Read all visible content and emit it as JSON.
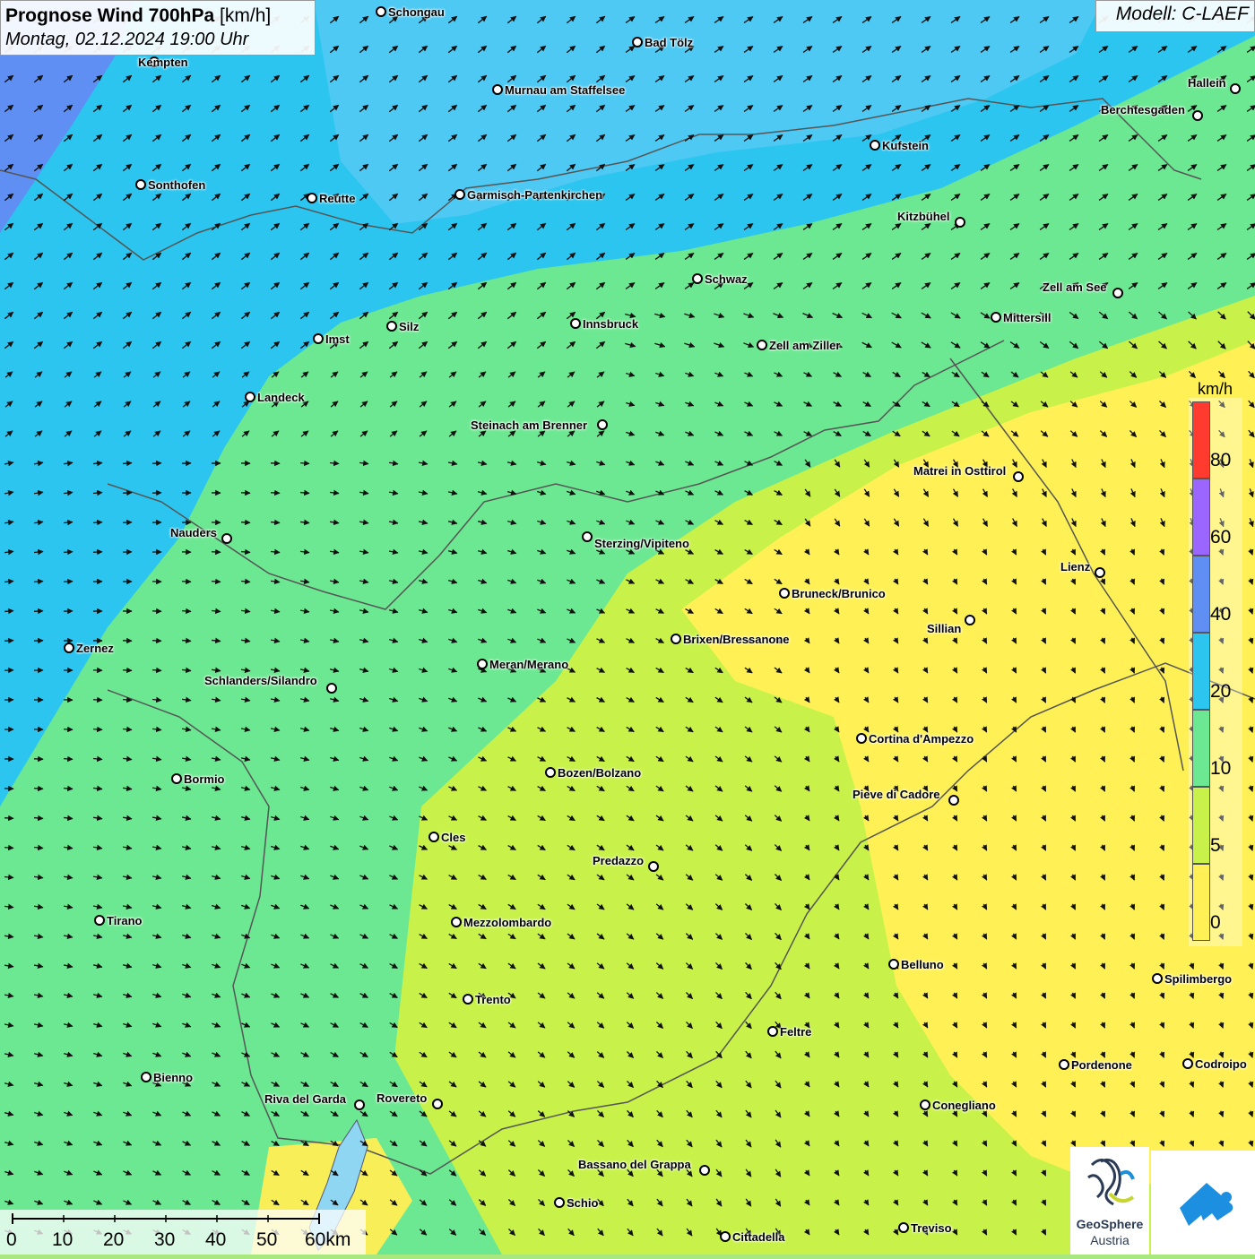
{
  "header": {
    "title_main": "Prognose Wind 700hPa",
    "title_unit": "[km/h]",
    "datetime": "Montag, 02.12.2024 19:00 Uhr",
    "model": "Modell: C-LAEF"
  },
  "legend": {
    "unit": "km/h",
    "labels": [
      "80",
      "60",
      "40",
      "20",
      "10",
      "5",
      "0"
    ],
    "colors": [
      "#ff3b30",
      "#9b66ff",
      "#5f8ff2",
      "#2bc5ef",
      "#6de892",
      "#c8f24a",
      "#fff155"
    ]
  },
  "scale_bar": {
    "labels": [
      "0",
      "10",
      "20",
      "30",
      "40",
      "50",
      "60km"
    ]
  },
  "logos": {
    "geosphere_line1": "GeoSphere",
    "geosphere_line2": "Austria",
    "app_icon": "wind-app-icon"
  },
  "colors": {
    "wind_0_5": "#fff155",
    "wind_5_10": "#c8f24a",
    "wind_10_20": "#6de892",
    "wind_20_40": "#2bc5ef",
    "wind_40_60": "#5f8ff2"
  },
  "cities": [
    {
      "name": "Schongau"
    },
    {
      "name": "Bad Tölz"
    },
    {
      "name": "Kempten"
    },
    {
      "name": "Murnau am Staffelsee"
    },
    {
      "name": "Hallein"
    },
    {
      "name": "Berchtesgaden"
    },
    {
      "name": "Kufstein"
    },
    {
      "name": "Sonthofen"
    },
    {
      "name": "Reutte"
    },
    {
      "name": "Garmisch-Partenkirchen"
    },
    {
      "name": "Kitzbühel"
    },
    {
      "name": "Schwaz"
    },
    {
      "name": "Zell am See"
    },
    {
      "name": "Innsbruck"
    },
    {
      "name": "Mittersill"
    },
    {
      "name": "Imst"
    },
    {
      "name": "Silz"
    },
    {
      "name": "Zell am Ziller"
    },
    {
      "name": "Landeck"
    },
    {
      "name": "Steinach am Brenner"
    },
    {
      "name": "Matrei in Osttirol"
    },
    {
      "name": "Nauders"
    },
    {
      "name": "Sterzing/Vipiteno"
    },
    {
      "name": "Lienz"
    },
    {
      "name": "Bruneck/Brunico"
    },
    {
      "name": "Sillian"
    },
    {
      "name": "Zernez"
    },
    {
      "name": "Brixen/Bressanone"
    },
    {
      "name": "Meran/Merano"
    },
    {
      "name": "Schlanders/Silandro"
    },
    {
      "name": "Cortina d'Ampezzo"
    },
    {
      "name": "Bozen/Bolzano"
    },
    {
      "name": "Bormio"
    },
    {
      "name": "Pieve di Cadore"
    },
    {
      "name": "Cles"
    },
    {
      "name": "Predazzo"
    },
    {
      "name": "Tirano"
    },
    {
      "name": "Mezzolombardo"
    },
    {
      "name": "Belluno"
    },
    {
      "name": "Spilimbergo"
    },
    {
      "name": "Trento"
    },
    {
      "name": "Feltre"
    },
    {
      "name": "Pordenone"
    },
    {
      "name": "Codroipo"
    },
    {
      "name": "Bienno"
    },
    {
      "name": "Riva del Garda"
    },
    {
      "name": "Rovereto"
    },
    {
      "name": "Conegliano"
    },
    {
      "name": "Bassano del Grappa"
    },
    {
      "name": "Schio"
    },
    {
      "name": "Treviso"
    },
    {
      "name": "Cittadella"
    }
  ]
}
